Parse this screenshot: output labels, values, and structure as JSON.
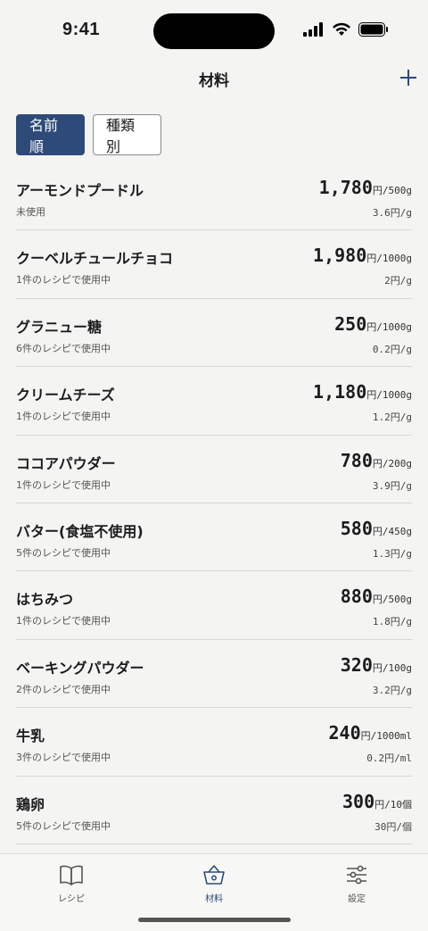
{
  "status_bar": {
    "time": "9:41"
  },
  "nav": {
    "title": "材料"
  },
  "segments": [
    {
      "label": "名前順",
      "active": true
    },
    {
      "label": "種類別",
      "active": false
    }
  ],
  "ingredients": [
    {
      "name": "アーモンドプードル",
      "usage": "未使用",
      "price": "1,780",
      "unit": "円/500g",
      "unit_price": "3.6円/g"
    },
    {
      "name": "クーベルチュールチョコ",
      "usage": "1件のレシピで使用中",
      "price": "1,980",
      "unit": "円/1000g",
      "unit_price": "2円/g"
    },
    {
      "name": "グラニュー糖",
      "usage": "6件のレシピで使用中",
      "price": "250",
      "unit": "円/1000g",
      "unit_price": "0.2円/g"
    },
    {
      "name": "クリームチーズ",
      "usage": "1件のレシピで使用中",
      "price": "1,180",
      "unit": "円/1000g",
      "unit_price": "1.2円/g"
    },
    {
      "name": "ココアパウダー",
      "usage": "1件のレシピで使用中",
      "price": "780",
      "unit": "円/200g",
      "unit_price": "3.9円/g"
    },
    {
      "name": "バター(食塩不使用)",
      "usage": "5件のレシピで使用中",
      "price": "580",
      "unit": "円/450g",
      "unit_price": "1.3円/g"
    },
    {
      "name": "はちみつ",
      "usage": "1件のレシピで使用中",
      "price": "880",
      "unit": "円/500g",
      "unit_price": "1.8円/g"
    },
    {
      "name": "ベーキングパウダー",
      "usage": "2件のレシピで使用中",
      "price": "320",
      "unit": "円/100g",
      "unit_price": "3.2円/g"
    },
    {
      "name": "牛乳",
      "usage": "3件のレシピで使用中",
      "price": "240",
      "unit": "円/1000ml",
      "unit_price": "0.2円/ml"
    },
    {
      "name": "鶏卵",
      "usage": "5件のレシピで使用中",
      "price": "300",
      "unit": "円/10個",
      "unit_price": "30円/個"
    }
  ],
  "tab_bar": {
    "tabs": [
      {
        "label": "レシピ",
        "icon": "book-icon",
        "active": false
      },
      {
        "label": "材料",
        "icon": "basket-icon",
        "active": true
      },
      {
        "label": "設定",
        "icon": "sliders-icon",
        "active": false
      }
    ]
  },
  "colors": {
    "accent": "#2e4a78",
    "background": "#f4f4f2"
  }
}
